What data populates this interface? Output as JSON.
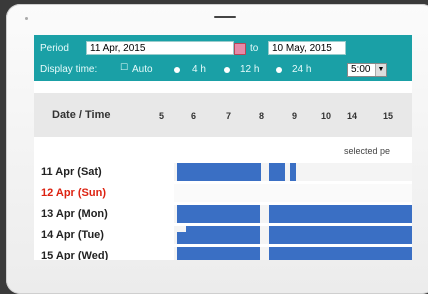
{
  "toolbar": {
    "period_label": "Period",
    "start_date": "11 Apr, 2015",
    "to_label": "to",
    "end_date": "10 May, 2015",
    "display_time_label": "Display time:",
    "auto_label": "Auto",
    "opt_4h": "4 h",
    "opt_12h": "12 h",
    "opt_24h": "24 h",
    "time_value": "5:00"
  },
  "grid": {
    "header": "Date / Time",
    "hours": [
      "5",
      "6",
      "7",
      "8",
      "9",
      "10",
      "14",
      "15"
    ],
    "selected_label": "selected pe",
    "rows": [
      {
        "label": "11 Apr (Sat)",
        "weekend": false
      },
      {
        "label": "12 Apr (Sun)",
        "weekend": true
      },
      {
        "label": "13 Apr (Mon)",
        "weekend": false
      },
      {
        "label": "14 Apr (Tue)",
        "weekend": false
      },
      {
        "label": "15 Apr (Wed)",
        "weekend": false
      }
    ]
  },
  "colors": {
    "toolbar": "#1aa0a6",
    "booked": "#3a6fc4",
    "weekend_text": "#d21"
  }
}
